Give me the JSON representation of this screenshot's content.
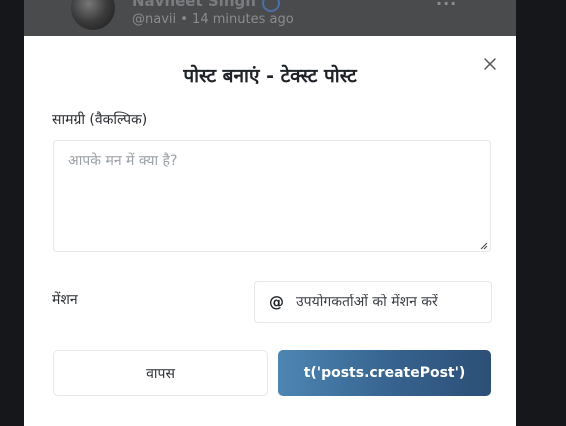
{
  "background_post": {
    "author_name": "Navneet Singh",
    "meta": "@navii  •  14 minutes ago",
    "more_icon": "more-options-icon"
  },
  "modal": {
    "title": "पोस्ट बनाएं - टेक्स्ट पोस्ट",
    "close_icon": "close-icon",
    "content": {
      "label": "सामग्री (वैकल्पिक)",
      "placeholder": "आपके मन में क्या है?",
      "value": ""
    },
    "mention": {
      "label": "मेंशन",
      "icon": "@",
      "placeholder": "उपयोगकर्ताओं को मेंशन करें",
      "value": ""
    },
    "buttons": {
      "back_label": "वापस",
      "create_label": "t('posts.createPost')"
    }
  },
  "colors": {
    "overlay": "#3a3b3d",
    "page_bg": "#15171b",
    "modal_bg": "#ffffff",
    "primary_gradient_start": "#4d86b3",
    "primary_gradient_end": "#2c4f76",
    "border": "#e6e7e9"
  }
}
